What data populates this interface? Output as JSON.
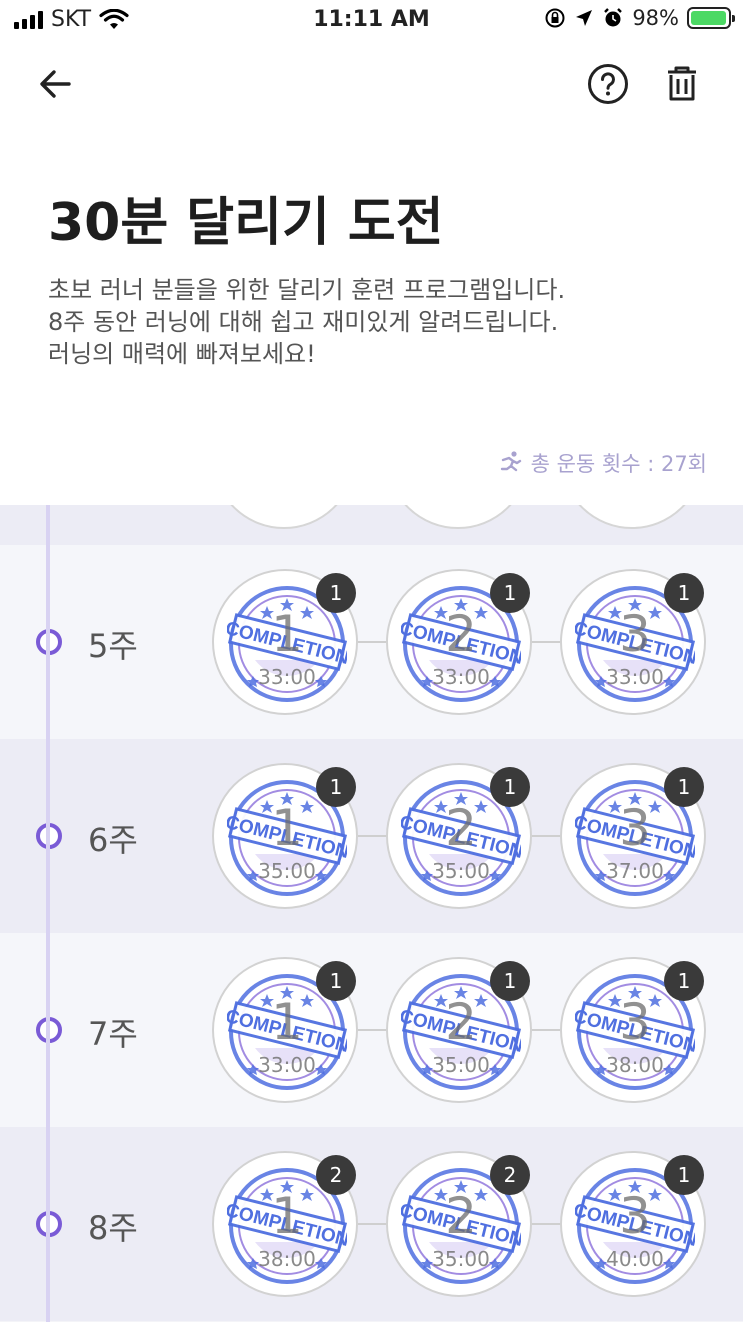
{
  "status_bar": {
    "carrier": "SKT",
    "time": "11:11 AM",
    "battery": "98%",
    "icons": [
      "signal-icon",
      "wifi-icon",
      "rotation-lock-icon",
      "location-icon",
      "alarm-icon",
      "battery-charging-icon"
    ]
  },
  "nav": {
    "icons": [
      "back-arrow-icon",
      "help-icon",
      "trash-icon"
    ]
  },
  "program": {
    "title": "30분 달리기 도전",
    "description": [
      "초보 러너 분들을 위한 달리기 훈련 프로그램입니다.",
      "8주 동안 러닝에 대해 쉽고 재미있게 알려드립니다.",
      "러닝의 매력에 빠져보세요!"
    ],
    "total_label": "총 운동 횟수 : 27회"
  },
  "weeks": [
    {
      "label": "5주",
      "sessions": [
        {
          "num": "1",
          "time": "33:00",
          "count": "1"
        },
        {
          "num": "2",
          "time": "33:00",
          "count": "1"
        },
        {
          "num": "3",
          "time": "33:00",
          "count": "1"
        }
      ]
    },
    {
      "label": "6주",
      "sessions": [
        {
          "num": "1",
          "time": "35:00",
          "count": "1"
        },
        {
          "num": "2",
          "time": "35:00",
          "count": "1"
        },
        {
          "num": "3",
          "time": "37:00",
          "count": "1"
        }
      ]
    },
    {
      "label": "7주",
      "sessions": [
        {
          "num": "1",
          "time": "33:00",
          "count": "1"
        },
        {
          "num": "2",
          "time": "35:00",
          "count": "1"
        },
        {
          "num": "3",
          "time": "38:00",
          "count": "1"
        }
      ]
    },
    {
      "label": "8주",
      "sessions": [
        {
          "num": "1",
          "time": "38:00",
          "count": "2"
        },
        {
          "num": "2",
          "time": "35:00",
          "count": "2"
        },
        {
          "num": "3",
          "time": "40:00",
          "count": "1"
        }
      ]
    }
  ],
  "stamp": {
    "text": "COMPLETION",
    "color": "#4f6fe0",
    "accent": "#7a5bd6"
  },
  "colors": {
    "accent": "#7a5bd6",
    "badge_count_bg": "#3a3a3a",
    "muted_label": "#a8a2cf"
  }
}
